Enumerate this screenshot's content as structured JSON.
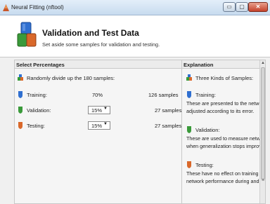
{
  "window": {
    "title": "Neural Fitting (nftool)",
    "minimize_label": "▭",
    "maximize_label": "▢",
    "close_label": "✕"
  },
  "header": {
    "title": "Validation and Test Data",
    "subtitle": "Set aside some samples for validation and testing."
  },
  "left_panel": {
    "title": "Select Percentages",
    "random_text": "Randomly divide up the 180 samples:",
    "rows": [
      {
        "label": "Training:",
        "percent": "70%",
        "samples": "126 samples",
        "icon": "blue-shield-icon"
      },
      {
        "label": "Validation:",
        "percent": "15%",
        "samples": "27 samples",
        "icon": "green-shield-icon"
      },
      {
        "label": "Testing:",
        "percent": "15%",
        "samples": "27 samples",
        "icon": "orange-shield-icon"
      }
    ]
  },
  "right_panel": {
    "title": "Explanation",
    "kinds_title": "Three Kinds of Samples:",
    "training_title": "Training:",
    "training_line1": "These are presented to the network",
    "training_line2": "adjusted according to its error.",
    "validation_title": "Validation:",
    "validation_line1": "These are used to measure network",
    "validation_line2": "when generalization stops improvin",
    "testing_title": "Testing:",
    "testing_line1": "These have no effect on training an",
    "testing_line2": "network performance during and af"
  },
  "colors": {
    "training": "#2f6fd0",
    "validation": "#3a9a3a",
    "testing": "#d9682a"
  }
}
